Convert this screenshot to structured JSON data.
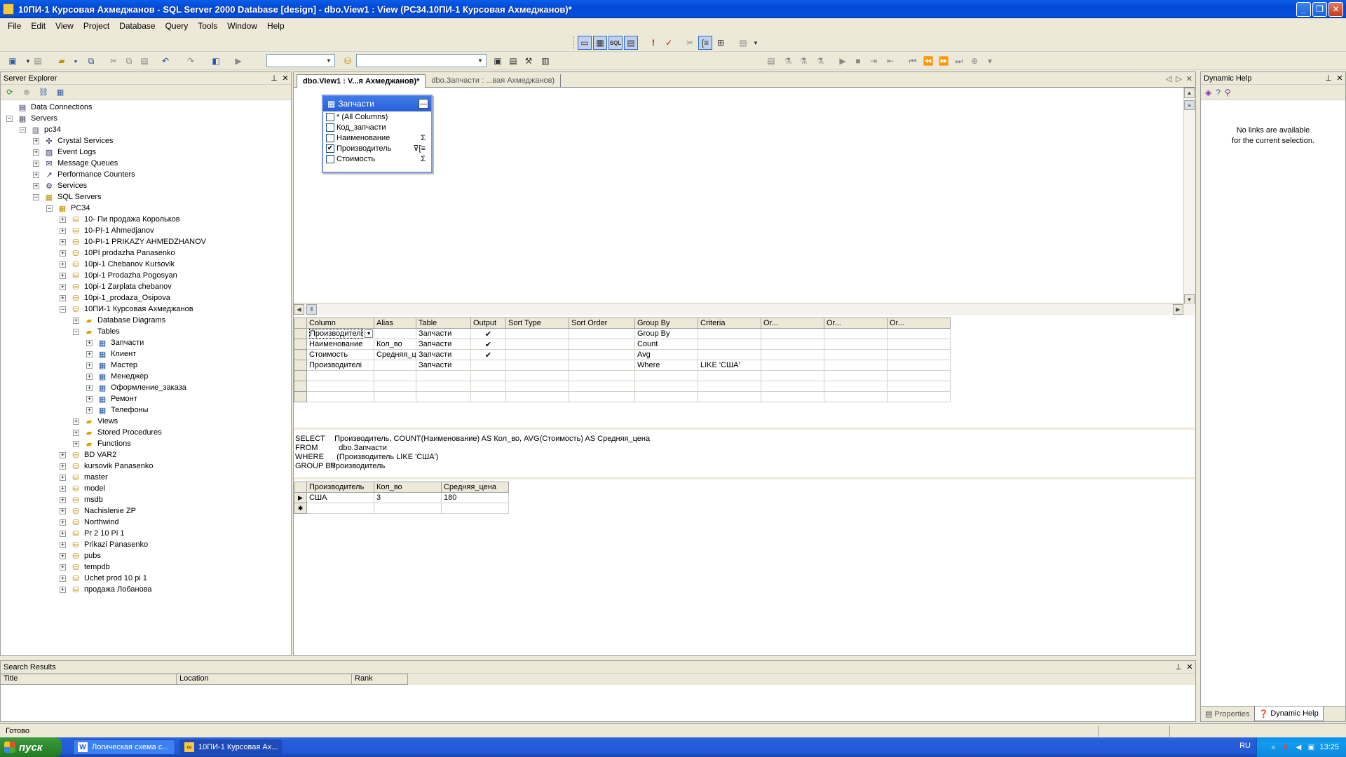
{
  "window": {
    "title": "10ПИ-1 Курсовая Ахмеджанов - SQL Server 2000 Database [design] - dbo.View1 : View (PC34.10ПИ-1 Курсовая Ахмеджанов)*"
  },
  "menu": [
    "File",
    "Edit",
    "View",
    "Project",
    "Database",
    "Query",
    "Tools",
    "Window",
    "Help"
  ],
  "server_explorer": {
    "title": "Server Explorer",
    "tree": [
      {
        "label": "Data Connections",
        "depth": 0,
        "exp": "",
        "icon": "database-connections-icon",
        "glyph": "▤",
        "cls": "ico-misc"
      },
      {
        "label": "Servers",
        "depth": 0,
        "exp": "−",
        "icon": "servers-icon",
        "glyph": "▦",
        "cls": "ico-server"
      },
      {
        "label": "pc34",
        "depth": 1,
        "exp": "−",
        "icon": "server-icon",
        "glyph": "▥",
        "cls": "ico-server"
      },
      {
        "label": "Crystal Services",
        "depth": 2,
        "exp": "+",
        "icon": "crystal-services-icon",
        "glyph": "✣",
        "cls": "ico-misc"
      },
      {
        "label": "Event Logs",
        "depth": 2,
        "exp": "+",
        "icon": "event-logs-icon",
        "glyph": "▧",
        "cls": "ico-misc"
      },
      {
        "label": "Message Queues",
        "depth": 2,
        "exp": "+",
        "icon": "message-queues-icon",
        "glyph": "✉",
        "cls": "ico-misc"
      },
      {
        "label": "Performance Counters",
        "depth": 2,
        "exp": "+",
        "icon": "performance-counters-icon",
        "glyph": "↗",
        "cls": "ico-misc"
      },
      {
        "label": "Services",
        "depth": 2,
        "exp": "+",
        "icon": "services-icon",
        "glyph": "⚙",
        "cls": "ico-misc"
      },
      {
        "label": "SQL Servers",
        "depth": 2,
        "exp": "−",
        "icon": "sql-servers-icon",
        "glyph": "▦",
        "cls": "ico-db"
      },
      {
        "label": "PC34",
        "depth": 3,
        "exp": "−",
        "icon": "sql-server-instance-icon",
        "glyph": "▦",
        "cls": "ico-db"
      },
      {
        "label": "10- Пи продажа Корольков",
        "depth": 4,
        "exp": "+",
        "icon": "database-icon",
        "glyph": "⛁",
        "cls": "ico-db"
      },
      {
        "label": "10-PI-1 Ahmedjanov",
        "depth": 4,
        "exp": "+",
        "icon": "database-icon",
        "glyph": "⛁",
        "cls": "ico-db"
      },
      {
        "label": "10-PI-1 PRIKAZY AHMEDZHANOV",
        "depth": 4,
        "exp": "+",
        "icon": "database-icon",
        "glyph": "⛁",
        "cls": "ico-db"
      },
      {
        "label": "10PI prodazha Panasenko",
        "depth": 4,
        "exp": "+",
        "icon": "database-icon",
        "glyph": "⛁",
        "cls": "ico-db"
      },
      {
        "label": "10pi-1 Chebanov Kursovik",
        "depth": 4,
        "exp": "+",
        "icon": "database-icon",
        "glyph": "⛁",
        "cls": "ico-db"
      },
      {
        "label": "10pi-1 Prodazha Pogosyan",
        "depth": 4,
        "exp": "+",
        "icon": "database-icon",
        "glyph": "⛁",
        "cls": "ico-db"
      },
      {
        "label": "10pi-1 Zarplata chebanov",
        "depth": 4,
        "exp": "+",
        "icon": "database-icon",
        "glyph": "⛁",
        "cls": "ico-db"
      },
      {
        "label": "10pi-1_prodaza_Osipova",
        "depth": 4,
        "exp": "+",
        "icon": "database-icon",
        "glyph": "⛁",
        "cls": "ico-db"
      },
      {
        "label": "10ПИ-1 Курсовая Ахмеджанов",
        "depth": 4,
        "exp": "−",
        "icon": "database-icon",
        "glyph": "⛁",
        "cls": "ico-db"
      },
      {
        "label": "Database Diagrams",
        "depth": 5,
        "exp": "+",
        "icon": "folder-icon",
        "glyph": "▰",
        "cls": "ico-folder"
      },
      {
        "label": "Tables",
        "depth": 5,
        "exp": "−",
        "icon": "folder-icon",
        "glyph": "▰",
        "cls": "ico-folder"
      },
      {
        "label": "Запчасти",
        "depth": 6,
        "exp": "+",
        "icon": "table-icon",
        "glyph": "▦",
        "cls": "ico-table"
      },
      {
        "label": "Клиент",
        "depth": 6,
        "exp": "+",
        "icon": "table-icon",
        "glyph": "▦",
        "cls": "ico-table"
      },
      {
        "label": "Мастер",
        "depth": 6,
        "exp": "+",
        "icon": "table-icon",
        "glyph": "▦",
        "cls": "ico-table"
      },
      {
        "label": "Менеджер",
        "depth": 6,
        "exp": "+",
        "icon": "table-icon",
        "glyph": "▦",
        "cls": "ico-table"
      },
      {
        "label": "Оформление_заказа",
        "depth": 6,
        "exp": "+",
        "icon": "table-icon",
        "glyph": "▦",
        "cls": "ico-table"
      },
      {
        "label": "Ремонт",
        "depth": 6,
        "exp": "+",
        "icon": "table-icon",
        "glyph": "▦",
        "cls": "ico-table"
      },
      {
        "label": "Телефоны",
        "depth": 6,
        "exp": "+",
        "icon": "table-icon",
        "glyph": "▦",
        "cls": "ico-table"
      },
      {
        "label": "Views",
        "depth": 5,
        "exp": "+",
        "icon": "folder-icon",
        "glyph": "▰",
        "cls": "ico-folder"
      },
      {
        "label": "Stored Procedures",
        "depth": 5,
        "exp": "+",
        "icon": "folder-icon",
        "glyph": "▰",
        "cls": "ico-folder"
      },
      {
        "label": "Functions",
        "depth": 5,
        "exp": "+",
        "icon": "folder-icon",
        "glyph": "▰",
        "cls": "ico-folder"
      },
      {
        "label": "BD VAR2",
        "depth": 4,
        "exp": "+",
        "icon": "database-icon",
        "glyph": "⛁",
        "cls": "ico-db"
      },
      {
        "label": "kursovik Panasenko",
        "depth": 4,
        "exp": "+",
        "icon": "database-icon",
        "glyph": "⛁",
        "cls": "ico-db"
      },
      {
        "label": "master",
        "depth": 4,
        "exp": "+",
        "icon": "database-icon",
        "glyph": "⛁",
        "cls": "ico-db"
      },
      {
        "label": "model",
        "depth": 4,
        "exp": "+",
        "icon": "database-icon",
        "glyph": "⛁",
        "cls": "ico-db"
      },
      {
        "label": "msdb",
        "depth": 4,
        "exp": "+",
        "icon": "database-icon",
        "glyph": "⛁",
        "cls": "ico-db"
      },
      {
        "label": "Nachislenie ZP",
        "depth": 4,
        "exp": "+",
        "icon": "database-icon",
        "glyph": "⛁",
        "cls": "ico-db"
      },
      {
        "label": "Northwind",
        "depth": 4,
        "exp": "+",
        "icon": "database-icon",
        "glyph": "⛁",
        "cls": "ico-db"
      },
      {
        "label": "Pr 2 10 Pi 1",
        "depth": 4,
        "exp": "+",
        "icon": "database-icon",
        "glyph": "⛁",
        "cls": "ico-db"
      },
      {
        "label": "Prikazi  Panasenko",
        "depth": 4,
        "exp": "+",
        "icon": "database-icon",
        "glyph": "⛁",
        "cls": "ico-db"
      },
      {
        "label": "pubs",
        "depth": 4,
        "exp": "+",
        "icon": "database-icon",
        "glyph": "⛁",
        "cls": "ico-db"
      },
      {
        "label": "tempdb",
        "depth": 4,
        "exp": "+",
        "icon": "database-icon",
        "glyph": "⛁",
        "cls": "ico-db"
      },
      {
        "label": "Uchet prod 10 pi 1",
        "depth": 4,
        "exp": "+",
        "icon": "database-icon",
        "glyph": "⛁",
        "cls": "ico-db"
      },
      {
        "label": "продажа Лобанова",
        "depth": 4,
        "exp": "+",
        "icon": "database-icon",
        "glyph": "⛁",
        "cls": "ico-db"
      }
    ]
  },
  "doc_tabs": {
    "active": "dbo.View1 : V...я Ахмеджанов)*",
    "inactive": "dbo.Запчасти : ...вая Ахмеджанов)"
  },
  "diagram": {
    "table_name": "Запчасти",
    "columns": [
      {
        "name": "* (All Columns)",
        "checked": false,
        "icon": ""
      },
      {
        "name": "Код_запчасти",
        "checked": false,
        "icon": ""
      },
      {
        "name": "Наименование",
        "checked": false,
        "icon": "Σ"
      },
      {
        "name": "Производитель",
        "checked": true,
        "icon": "⊽[≡"
      },
      {
        "name": "Стоимость",
        "checked": false,
        "icon": "Σ"
      }
    ]
  },
  "criteria": {
    "headers": [
      "Column",
      "Alias",
      "Table",
      "Output",
      "Sort Type",
      "Sort Order",
      "Group By",
      "Criteria",
      "Or...",
      "Or...",
      "Or..."
    ],
    "rows": [
      [
        "Производителі",
        "",
        "Запчасти",
        "✔",
        "",
        "",
        "Group By",
        "",
        "",
        "",
        ""
      ],
      [
        "Наименование",
        "Кол_во",
        "Запчасти",
        "✔",
        "",
        "",
        "Count",
        "",
        "",
        "",
        ""
      ],
      [
        "Стоимость",
        "Средняя_ц",
        "Запчасти",
        "✔",
        "",
        "",
        "Avg",
        "",
        "",
        "",
        ""
      ],
      [
        "Производителі",
        "",
        "Запчасти",
        "",
        "",
        "",
        "Where",
        "LIKE 'США'",
        "",
        "",
        ""
      ],
      [
        "",
        "",
        "",
        "",
        "",
        "",
        "",
        "",
        "",
        "",
        ""
      ],
      [
        "",
        "",
        "",
        "",
        "",
        "",
        "",
        "",
        "",
        "",
        ""
      ],
      [
        "",
        "",
        "",
        "",
        "",
        "",
        "",
        "",
        "",
        "",
        ""
      ]
    ]
  },
  "sql": {
    "lines": [
      [
        "SELECT",
        "  Производитель, COUNT(Наименование) AS Кол_во, AVG(Стоимость) AS Средняя_цена"
      ],
      [
        "FROM",
        "    dbo.Запчасти"
      ],
      [
        "WHERE",
        "   (Производитель LIKE 'США')"
      ],
      [
        "GROUP BY",
        "Производитель"
      ]
    ]
  },
  "results": {
    "headers": [
      "Производитель",
      "Кол_во",
      "Средняя_цена"
    ],
    "rows": [
      [
        "США",
        "3",
        "180"
      ],
      [
        "",
        "",
        ""
      ]
    ]
  },
  "dynamic_help": {
    "title": "Dynamic Help",
    "message_l1": "No links are available",
    "message_l2": "for the current selection.",
    "tab_properties": "Properties",
    "tab_help": "Dynamic Help"
  },
  "search_results": {
    "title": "Search Results",
    "columns": [
      "Title",
      "Location",
      "Rank"
    ]
  },
  "status": {
    "text": "Готово"
  },
  "taskbar": {
    "start": "пуск",
    "tasks": [
      "Логическая схема с...",
      "10ПИ-1 Курсовая Ах..."
    ],
    "lang": "RU",
    "clock": "13:25"
  }
}
